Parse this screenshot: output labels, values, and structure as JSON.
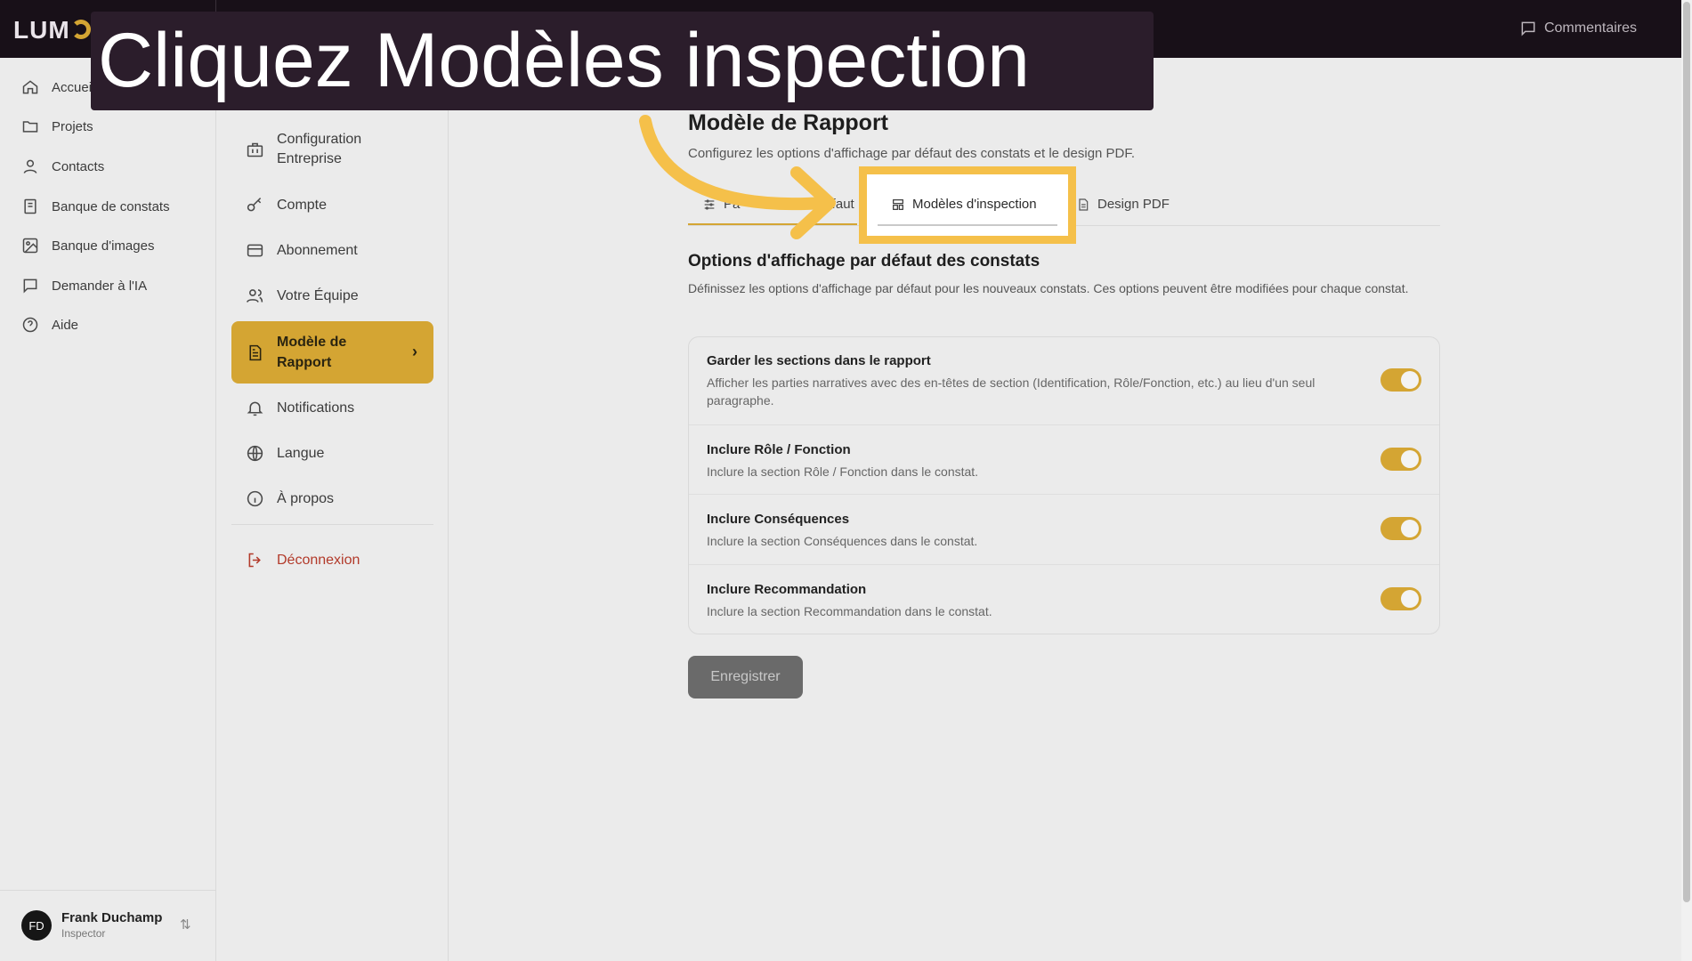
{
  "topbar": {
    "logo": "LUM",
    "feedback_label": "Commentaires"
  },
  "sidebar": {
    "items": [
      {
        "label": "Accueil",
        "icon": "home-icon"
      },
      {
        "label": "Projets",
        "icon": "folder-icon"
      },
      {
        "label": "Contacts",
        "icon": "user-icon"
      },
      {
        "label": "Banque de constats",
        "icon": "book-icon"
      },
      {
        "label": "Banque d'images",
        "icon": "image-icon"
      },
      {
        "label": "Demander à l'IA",
        "icon": "chat-icon"
      },
      {
        "label": "Aide",
        "icon": "help-icon"
      }
    ],
    "user": {
      "initials": "FD",
      "name": "Frank Duchamp",
      "role": "Inspector",
      "switch": "⇅"
    }
  },
  "settings_nav": {
    "items": [
      {
        "label": "Configuration Entreprise",
        "icon": "briefcase-icon"
      },
      {
        "label": "Compte",
        "icon": "key-icon"
      },
      {
        "label": "Abonnement",
        "icon": "credit-card-icon"
      },
      {
        "label": "Votre Équipe",
        "icon": "users-icon"
      },
      {
        "label": "Modèle de Rapport",
        "icon": "document-icon",
        "active": true
      },
      {
        "label": "Notifications",
        "icon": "bell-icon"
      },
      {
        "label": "Langue",
        "icon": "globe-icon"
      },
      {
        "label": "À propos",
        "icon": "info-icon"
      }
    ],
    "logout": "Déconnexion"
  },
  "main": {
    "title": "Modèle de Rapport",
    "subtitle": "Configurez les options d'affichage par défaut des constats et le design PDF.",
    "tabs": [
      {
        "label": "Par défaut",
        "visible_fragment_a": "Pa",
        "visible_fragment_b": "défaut"
      },
      {
        "label": "Modèles d'inspection"
      },
      {
        "label": "Design PDF"
      }
    ],
    "section_title": "Options d'affichage par défaut des constats",
    "section_desc": "Définissez les options d'affichage par défaut pour les nouveaux constats. Ces options peuvent être modifiées pour chaque constat.",
    "options": [
      {
        "title": "Garder les sections dans le rapport",
        "desc": "Afficher les parties narratives avec des en-têtes de section (Identification, Rôle/Fonction, etc.) au lieu d'un seul paragraphe.",
        "enabled": true
      },
      {
        "title": "Inclure Rôle / Fonction",
        "desc": "Inclure la section Rôle / Fonction dans le constat.",
        "enabled": true
      },
      {
        "title": "Inclure Conséquences",
        "desc": "Inclure la section Conséquences dans le constat.",
        "enabled": true
      },
      {
        "title": "Inclure Recommandation",
        "desc": "Inclure la section Recommandation dans le constat.",
        "enabled": true
      }
    ],
    "save_label": "Enregistrer"
  },
  "overlay": {
    "caption": "Cliquez Modèles inspection"
  },
  "colors": {
    "accent": "#d4a533",
    "highlight": "#f5c04a",
    "topbar": "#181018",
    "caption_bg": "#2b1d2b"
  }
}
